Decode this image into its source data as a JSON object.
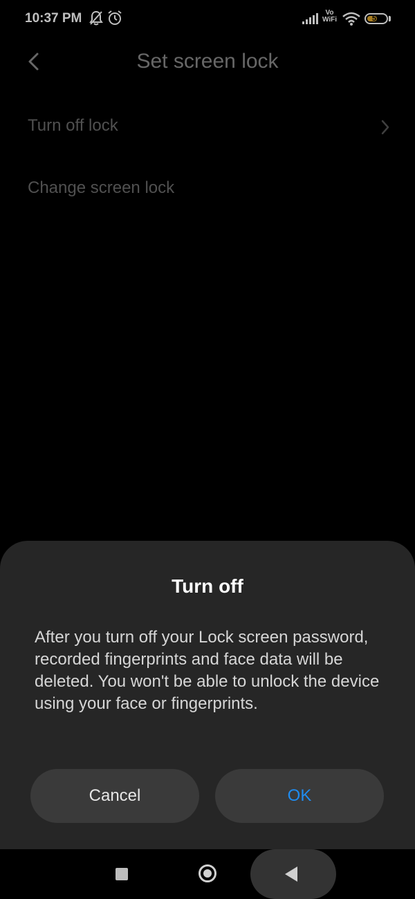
{
  "status_bar": {
    "time": "10:37 PM",
    "icons": [
      "bell-off-icon",
      "alarm-icon",
      "signal-icon",
      "vowifi-icon",
      "wifi-icon",
      "battery-icon"
    ],
    "vowifi_top": "Vo",
    "vowifi_bottom": "WiFi",
    "battery_level": "55",
    "battery_color": "#e0a72b"
  },
  "header": {
    "title": "Set screen lock",
    "back_icon": "chevron-left-icon"
  },
  "list": {
    "items": [
      {
        "label": "Turn off lock",
        "has_chevron": true
      },
      {
        "label": "Change screen lock",
        "has_chevron": false
      }
    ]
  },
  "dialog": {
    "title": "Turn off",
    "message": "After you turn off your Lock screen password, recorded fingerprints and face data will be deleted. You won't be able to unlock the device using your face or fingerprints.",
    "cancel_label": "Cancel",
    "ok_label": "OK",
    "ok_color": "#1f8cf0"
  },
  "nav_bar": {
    "icons": [
      "recents-square-icon",
      "home-circle-icon",
      "back-triangle-icon"
    ]
  }
}
